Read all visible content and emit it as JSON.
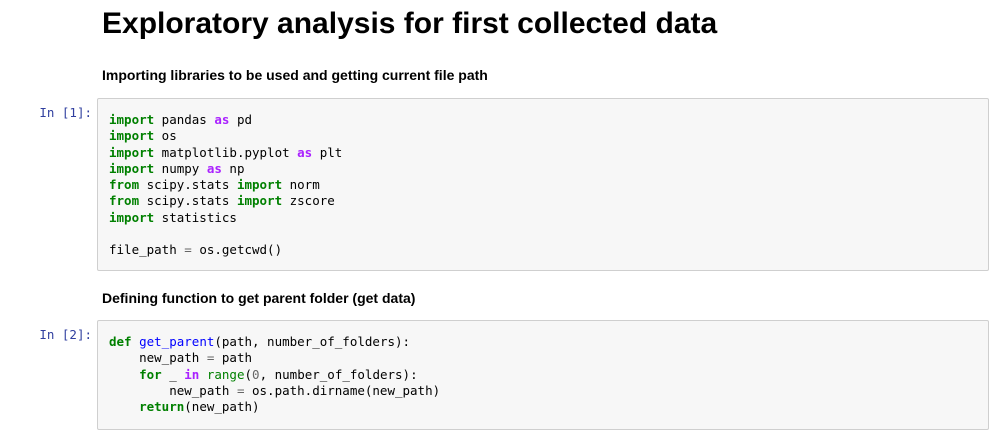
{
  "notebook": {
    "title": "Exploratory analysis for first collected data",
    "cells": [
      {
        "markdown": "Importing libraries to be used and getting current file path",
        "prompt": "In [1]:",
        "code_lines": [
          "import pandas as pd",
          "import os",
          "import matplotlib.pyplot as plt",
          "import numpy as np",
          "from scipy.stats import norm",
          "from scipy.stats import zscore",
          "import statistics",
          "",
          "file_path = os.getcwd()"
        ]
      },
      {
        "markdown": "Defining function to get parent folder (get data)",
        "prompt": "In [2]:",
        "code_lines": [
          "def get_parent(path, number_of_folders):",
          "    new_path = path",
          "    for _ in range(0, number_of_folders):",
          "        new_path = os.path.dirname(new_path)",
          "    return(new_path)"
        ]
      }
    ]
  },
  "colors": {
    "prompt": "#303f9f",
    "keyword": "#008000",
    "operator_word": "#aa22ff",
    "cell_background": "#f7f7f7",
    "cell_border": "#cfcfcf"
  }
}
